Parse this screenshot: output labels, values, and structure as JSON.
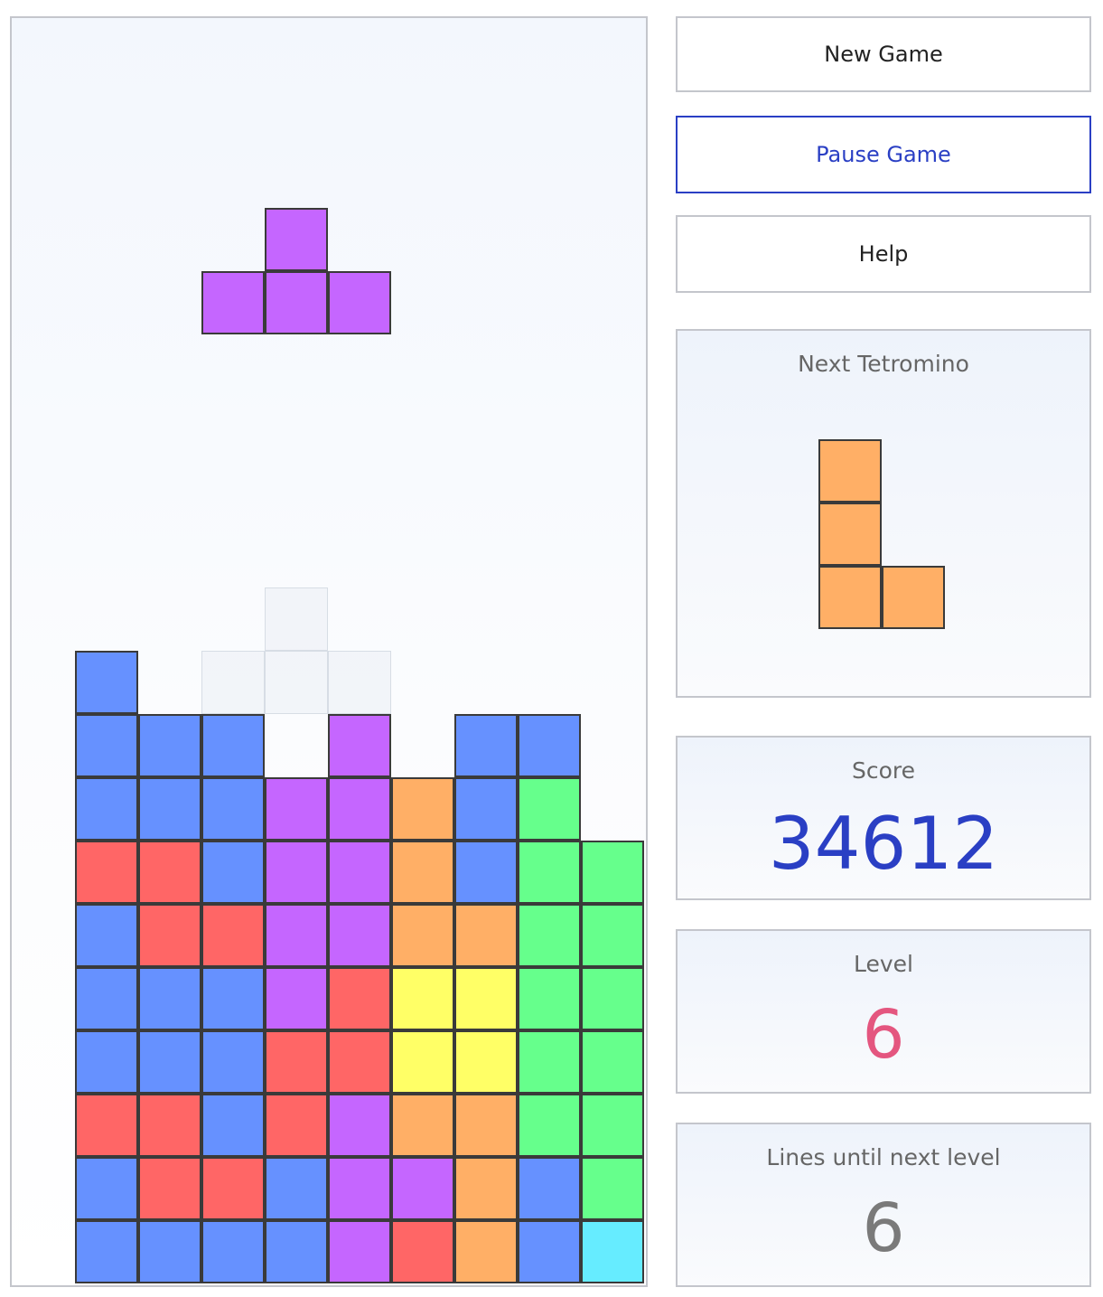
{
  "colors": {
    "blue": "#6691ff",
    "purple": "#c566ff",
    "orange": "#ffaf66",
    "green": "#66ff8c",
    "red": "#ff6666",
    "yellow": "#ffff66",
    "cyan": "#66ecff",
    "accent": "#2a3fc4",
    "level": "#e4567f",
    "lines": "#7a7a7a"
  },
  "board": {
    "cols": 10,
    "rows": 20,
    "active_piece": {
      "type": "T",
      "color": "purple",
      "cells": [
        [
          4,
          3
        ],
        [
          3,
          4
        ],
        [
          4,
          4
        ],
        [
          5,
          4
        ]
      ]
    },
    "ghost_piece": {
      "cells": [
        [
          4,
          9
        ],
        [
          3,
          10
        ],
        [
          4,
          10
        ],
        [
          5,
          10
        ]
      ]
    },
    "stack": [
      [
        null,
        "blue",
        null,
        null,
        null,
        null,
        null,
        null,
        null,
        null
      ],
      [
        null,
        "blue",
        "blue",
        "blue",
        null,
        "purple",
        null,
        "blue",
        "blue",
        null
      ],
      [
        null,
        "blue",
        "blue",
        "blue",
        "purple",
        "purple",
        "orange",
        "blue",
        "green",
        null
      ],
      [
        null,
        "red",
        "red",
        "blue",
        "purple",
        "purple",
        "orange",
        "blue",
        "green",
        "green"
      ],
      [
        null,
        "blue",
        "red",
        "red",
        "purple",
        "purple",
        "orange",
        "orange",
        "green",
        "green"
      ],
      [
        null,
        "blue",
        "blue",
        "blue",
        "purple",
        "red",
        "yellow",
        "yellow",
        "green",
        "green"
      ],
      [
        null,
        "blue",
        "blue",
        "blue",
        "red",
        "red",
        "yellow",
        "yellow",
        "green",
        "green"
      ],
      [
        null,
        "red",
        "red",
        "blue",
        "red",
        "purple",
        "orange",
        "orange",
        "green",
        "green"
      ],
      [
        null,
        "blue",
        "red",
        "red",
        "blue",
        "purple",
        "purple",
        "orange",
        "blue",
        "green"
      ],
      [
        null,
        "blue",
        "blue",
        "blue",
        "blue",
        "purple",
        "red",
        "orange",
        "blue",
        "cyan"
      ]
    ],
    "stack_top_row": 10
  },
  "buttons": {
    "new_game": "New Game",
    "pause_game": "Pause Game",
    "help": "Help"
  },
  "next": {
    "label": "Next Tetromino",
    "type": "L",
    "color": "orange",
    "cells": [
      [
        0,
        0
      ],
      [
        0,
        1
      ],
      [
        0,
        2
      ],
      [
        1,
        2
      ]
    ]
  },
  "score": {
    "label": "Score",
    "value": "34612"
  },
  "level": {
    "label": "Level",
    "value": "6"
  },
  "lines": {
    "label": "Lines until next level",
    "value": "6"
  }
}
